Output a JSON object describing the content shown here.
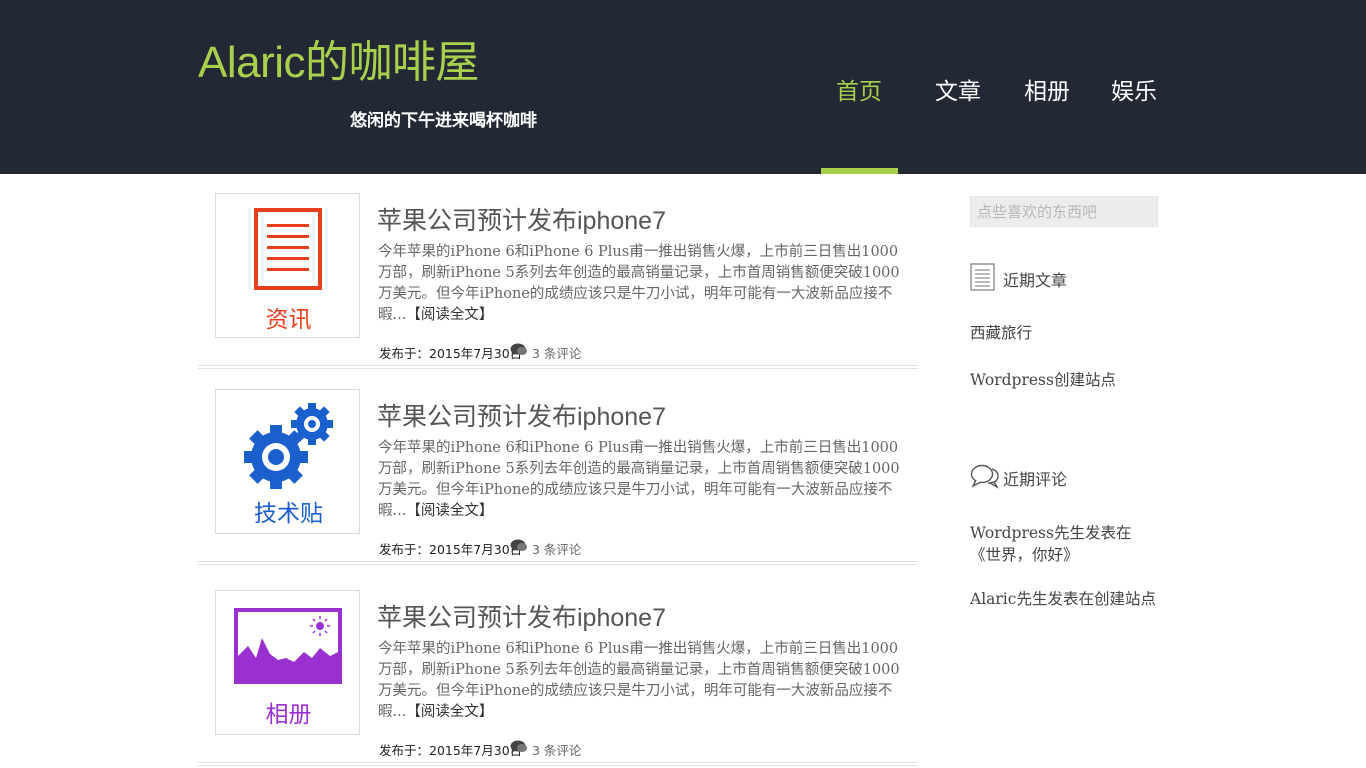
{
  "header": {
    "site_title": "Alaric的咖啡屋",
    "tagline": "悠闲的下午进来喝杯咖啡",
    "nav": [
      {
        "label": "首页",
        "active": true
      },
      {
        "label": "文章",
        "active": false
      },
      {
        "label": "相册",
        "active": false
      },
      {
        "label": "娱乐",
        "active": false
      }
    ],
    "accent_color": "#a8d04c",
    "background_color": "#222834"
  },
  "posts": [
    {
      "category": "资讯",
      "category_color": "#e8401c",
      "icon": "document-icon",
      "title": "苹果公司预计发布iphone7",
      "excerpt": "今年苹果的iPhone 6和iPhone 6 Plus甫一推出销售火爆，上市前三日售出1000万部，刷新iPhone 5系列去年创造的最高销量记录，上市首周销售额便突破1000万美元。但今年iPhone的成绩应该只是牛刀小试，明年可能有一大波新品应接不暇...",
      "read_more": "【阅读全文】",
      "date": "发布于：2015年7月30日",
      "comments": "3 条评论"
    },
    {
      "category": "技术贴",
      "category_color": "#1a5fcc",
      "icon": "gears-icon",
      "title": "苹果公司预计发布iphone7",
      "excerpt": "今年苹果的iPhone 6和iPhone 6 Plus甫一推出销售火爆，上市前三日售出1000万部，刷新iPhone 5系列去年创造的最高销量记录，上市首周销售额便突破1000万美元。但今年iPhone的成绩应该只是牛刀小试，明年可能有一大波新品应接不暇...",
      "read_more": "【阅读全文】",
      "date": "发布于：2015年7月30日",
      "comments": "3 条评论"
    },
    {
      "category": "相册",
      "category_color": "#9b30d0",
      "icon": "image-icon",
      "title": "苹果公司预计发布iphone7",
      "excerpt": "今年苹果的iPhone 6和iPhone 6 Plus甫一推出销售火爆，上市前三日售出1000万部，刷新iPhone 5系列去年创造的最高销量记录，上市首周销售额便突破1000万美元。但今年iPhone的成绩应该只是牛刀小试，明年可能有一大波新品应接不暇...",
      "read_more": "【阅读全文】",
      "date": "发布于：2015年7月30日",
      "comments": "3 条评论"
    }
  ],
  "sidebar": {
    "search_placeholder": "点些喜欢的东西吧",
    "recent_posts_title": "近期文章",
    "recent_posts": [
      "西藏旅行",
      "Wordpress创建站点"
    ],
    "recent_comments_title": "近期评论",
    "recent_comments": [
      "Wordpress先生发表在《世界，你好》",
      "Alaric先生发表在创建站点"
    ]
  }
}
